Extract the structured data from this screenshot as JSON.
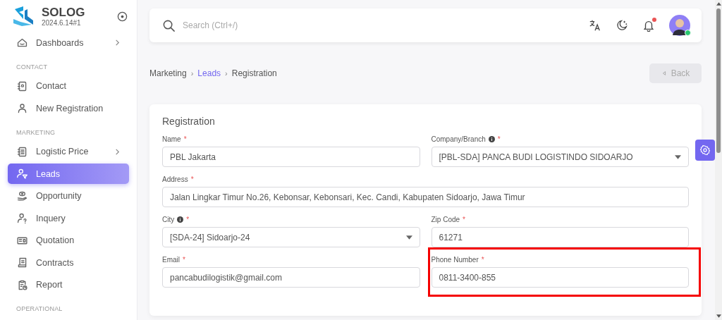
{
  "brand": {
    "name": "SOLOG",
    "version": "2024.6.14#1"
  },
  "sidebar": {
    "items": [
      {
        "kind": "item",
        "label": "Dashboards",
        "has_children": true,
        "selected": false
      },
      {
        "kind": "section",
        "label": "CONTACT"
      },
      {
        "kind": "item",
        "label": "Contact",
        "has_children": false,
        "selected": false
      },
      {
        "kind": "item",
        "label": "New Registration",
        "has_children": false,
        "selected": false
      },
      {
        "kind": "section",
        "label": "MARKETING"
      },
      {
        "kind": "item",
        "label": "Logistic Price",
        "has_children": true,
        "selected": false
      },
      {
        "kind": "item",
        "label": "Leads",
        "has_children": false,
        "selected": true
      },
      {
        "kind": "item",
        "label": "Opportunity",
        "has_children": false,
        "selected": false
      },
      {
        "kind": "item",
        "label": "Inquery",
        "has_children": false,
        "selected": false
      },
      {
        "kind": "item",
        "label": "Quotation",
        "has_children": false,
        "selected": false
      },
      {
        "kind": "item",
        "label": "Contracts",
        "has_children": false,
        "selected": false
      },
      {
        "kind": "item",
        "label": "Report",
        "has_children": false,
        "selected": false
      },
      {
        "kind": "section",
        "label": "OPERATIONAL"
      }
    ]
  },
  "topbar": {
    "search": {
      "placeholder": "Search (Ctrl+/)"
    },
    "notification": true,
    "online": true
  },
  "breadcrumb_separator": "›",
  "breadcrumb": [
    {
      "label": "Marketing",
      "link": false
    },
    {
      "label": "Leads",
      "link": true
    },
    {
      "label": "Registration",
      "link": false
    }
  ],
  "back_button": {
    "label": "Back",
    "disabled": true
  },
  "form": {
    "title": "Registration",
    "required_mark": "*",
    "rows": [
      [
        {
          "kind": "text",
          "label": "Name",
          "info": false,
          "required": true,
          "value": "PBL Jakarta",
          "highlighted": false
        },
        {
          "kind": "select",
          "label": "Company/Branch",
          "info": true,
          "required": true,
          "value": "[PBL-SDA] PANCA BUDI LOGISTINDO SIDOARJO",
          "highlighted": false
        }
      ],
      [
        {
          "kind": "text",
          "label": "Address",
          "info": false,
          "required": true,
          "value": "Jalan Lingkar Timur No.26, Kebonsar, Kebonsari, Kec. Candi, Kabupaten Sidoarjo, Jawa Timur",
          "highlighted": false
        }
      ],
      [
        {
          "kind": "select",
          "label": "City",
          "info": true,
          "required": true,
          "value": "[SDA-24] Sidoarjo-24",
          "highlighted": false
        },
        {
          "kind": "text",
          "label": "Zip Code",
          "info": false,
          "required": true,
          "value": "61271",
          "highlighted": false
        }
      ],
      [
        {
          "kind": "text",
          "label": "Email",
          "info": false,
          "required": true,
          "value": "pancabudilogistik@gmail.com",
          "highlighted": false
        },
        {
          "kind": "text",
          "label": "Phone Number",
          "info": false,
          "required": true,
          "value": "0811-3400-855",
          "highlighted": true
        }
      ]
    ]
  }
}
